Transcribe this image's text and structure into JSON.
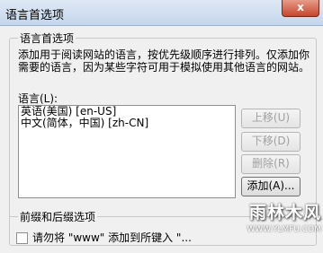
{
  "window": {
    "title": "语言首选项",
    "close_label": "x"
  },
  "section": {
    "title": "语言首选项",
    "description": "添加用于阅读网站的语言，按优先级顺序进行排列。仅添加你需要的语言，因为某些字符可用于模拟使用其他语言的网站。"
  },
  "language_list": {
    "label": "语言(L):",
    "items": [
      "英语(美国) [en-US]",
      "中文(简体，中国) [zh-CN]"
    ]
  },
  "buttons": {
    "move_up": "上移(U)",
    "move_down": "下移(D)",
    "remove": "删除(R)",
    "add": "添加(A)..."
  },
  "prefix_suffix": {
    "title": "前缀和后缀选项",
    "checkbox_label": "请勿将 \"www\" 添加到所键入 \"..."
  },
  "watermark": {
    "main": "雨林木风",
    "sub": "WWW.YLMFU.COM"
  }
}
